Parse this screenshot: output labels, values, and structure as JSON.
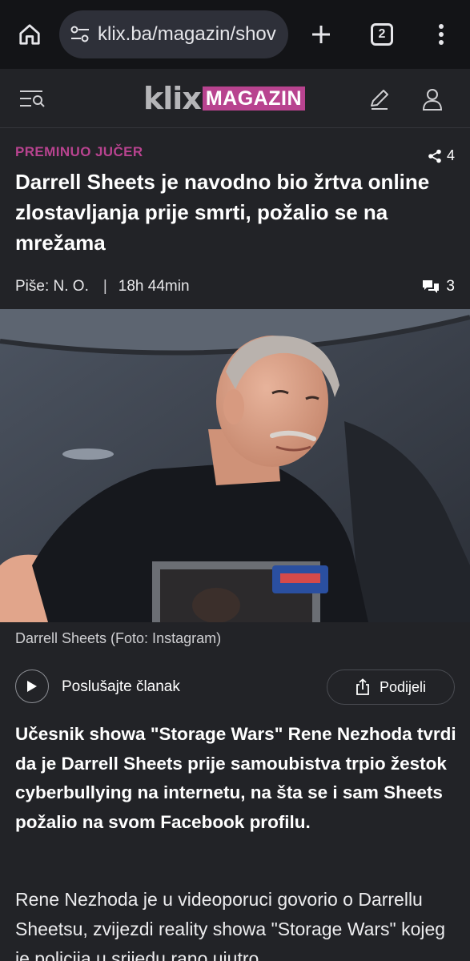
{
  "browser": {
    "url": "klix.ba/magazin/shov",
    "tab_count": "2",
    "icons": [
      "home-icon",
      "tune-icon",
      "plus-icon",
      "tabs-icon",
      "more-vert-icon"
    ]
  },
  "site": {
    "logo_main": "klix",
    "logo_section": "MAGAZIN",
    "accent_color": "#b8438f",
    "icons": [
      "search-menu-icon",
      "pen-icon",
      "user-icon"
    ]
  },
  "article": {
    "kicker": "PREMINUO JUČER",
    "share_count": "4",
    "headline": "Darrell Sheets je navodno bio žrtva online zlostavljanja prije smrti, požalio se na mrežama",
    "author": "Piše: N. O.",
    "separator": "|",
    "time_ago": "18h 44min",
    "comment_count": "3",
    "photo_caption": "Darrell Sheets (Foto: Instagram)",
    "listen_label": "Poslušajte članak",
    "share_label": "Podijeli",
    "lead": "Učesnik showa \"Storage Wars\" Rene Nezhoda tvrdi da je Darrell Sheets prije samoubistva trpio žestok cyberbullying na internetu, na šta se i sam Sheets požalio na svom Facebook profilu.",
    "paragraph": "Rene Nezhoda je u videoporuci govorio o Darrellu Sheetsu, zvijezdi reality showa \"Storage Wars\" kojeg je policija u srijedu rano ujutro"
  }
}
